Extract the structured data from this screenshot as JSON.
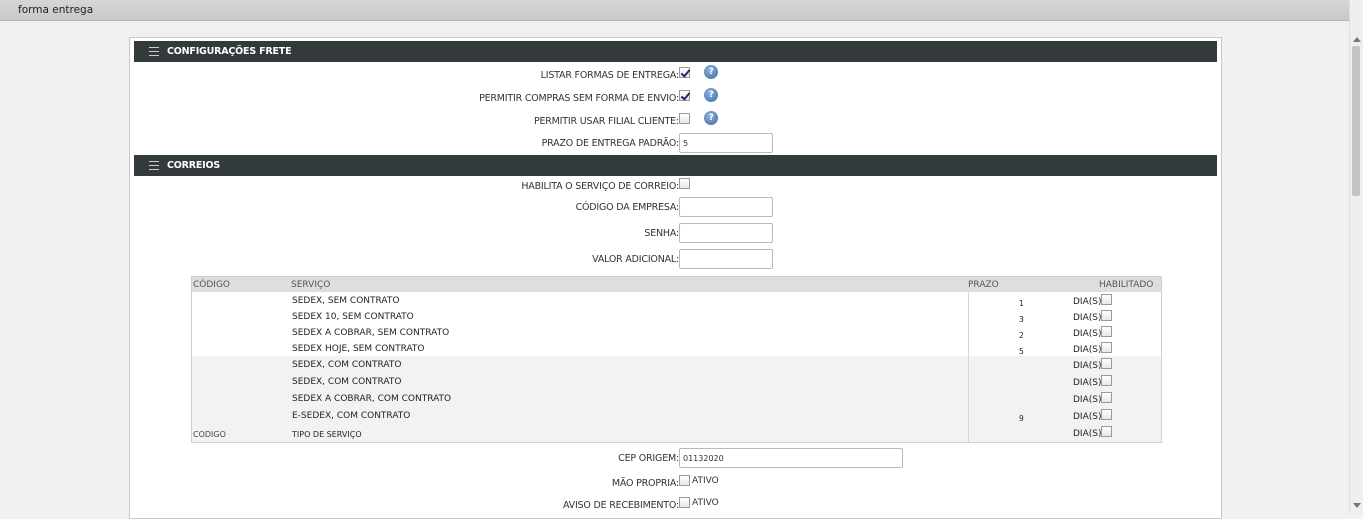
{
  "window": {
    "title": "forma entrega"
  },
  "sections": {
    "frete": "CONFIGURAÇÕES FRETE",
    "correios": "CORREIOS"
  },
  "frete": {
    "listar_label": "LISTAR FORMAS DE ENTREGA:",
    "listar_checked": true,
    "permitir_compras_label": "PERMITIR COMPRAS SEM FORMA DE ENVIO:",
    "permitir_compras_checked": true,
    "filial_label": "PERMITIR USAR FILIAL CLIENTE:",
    "filial_checked": false,
    "prazo_label": "PRAZO DE ENTREGA PADRÃO:",
    "prazo_value": "5",
    "help_glyph": "?"
  },
  "correios": {
    "habilita_label": "HABILITA O SERVIÇO DE CORREIO:",
    "codigo_empresa_label": "CÓDIGO DA EMPRESA:",
    "senha_label": "SENHA:",
    "valor_adicional_label": "VALOR ADICIONAL:",
    "cep_origem_label": "CEP ORIGEM:",
    "cep_origem_value": "01132020",
    "mao_propria_label": "MÃO PROPRIA:",
    "aviso_label": "AVISO DE RECEBIMENTO:",
    "ativo_text": "ATIVO"
  },
  "table": {
    "headers": {
      "codigo": "CÓDIGO",
      "servico": "SERVIÇO",
      "prazo": "PRAZO",
      "habilitado": "HABILITADO"
    },
    "dias_text": "DIA(S)",
    "rows": [
      {
        "code": "",
        "service": "SEDEX, SEM CONTRATO",
        "prazo": "1"
      },
      {
        "code": "",
        "service": "SEDEX 10, SEM CONTRATO",
        "prazo": "3"
      },
      {
        "code": "",
        "service": "SEDEX A COBRAR, SEM CONTRATO",
        "prazo": "2"
      },
      {
        "code": "",
        "service": "SEDEX HOJE, SEM CONTRATO",
        "prazo": "5"
      },
      {
        "code": "",
        "service": "SEDEX, COM CONTRATO",
        "prazo": ""
      },
      {
        "code": "",
        "service": "SEDEX, COM CONTRATO",
        "prazo": ""
      },
      {
        "code": "",
        "service": "SEDEX A COBRAR, COM CONTRATO",
        "prazo": ""
      },
      {
        "code": "",
        "service": "E-SEDEX, COM CONTRATO",
        "prazo": "9"
      },
      {
        "code": "CODIGO",
        "service": "TIPO DE SERVIÇO",
        "prazo": ""
      }
    ]
  }
}
